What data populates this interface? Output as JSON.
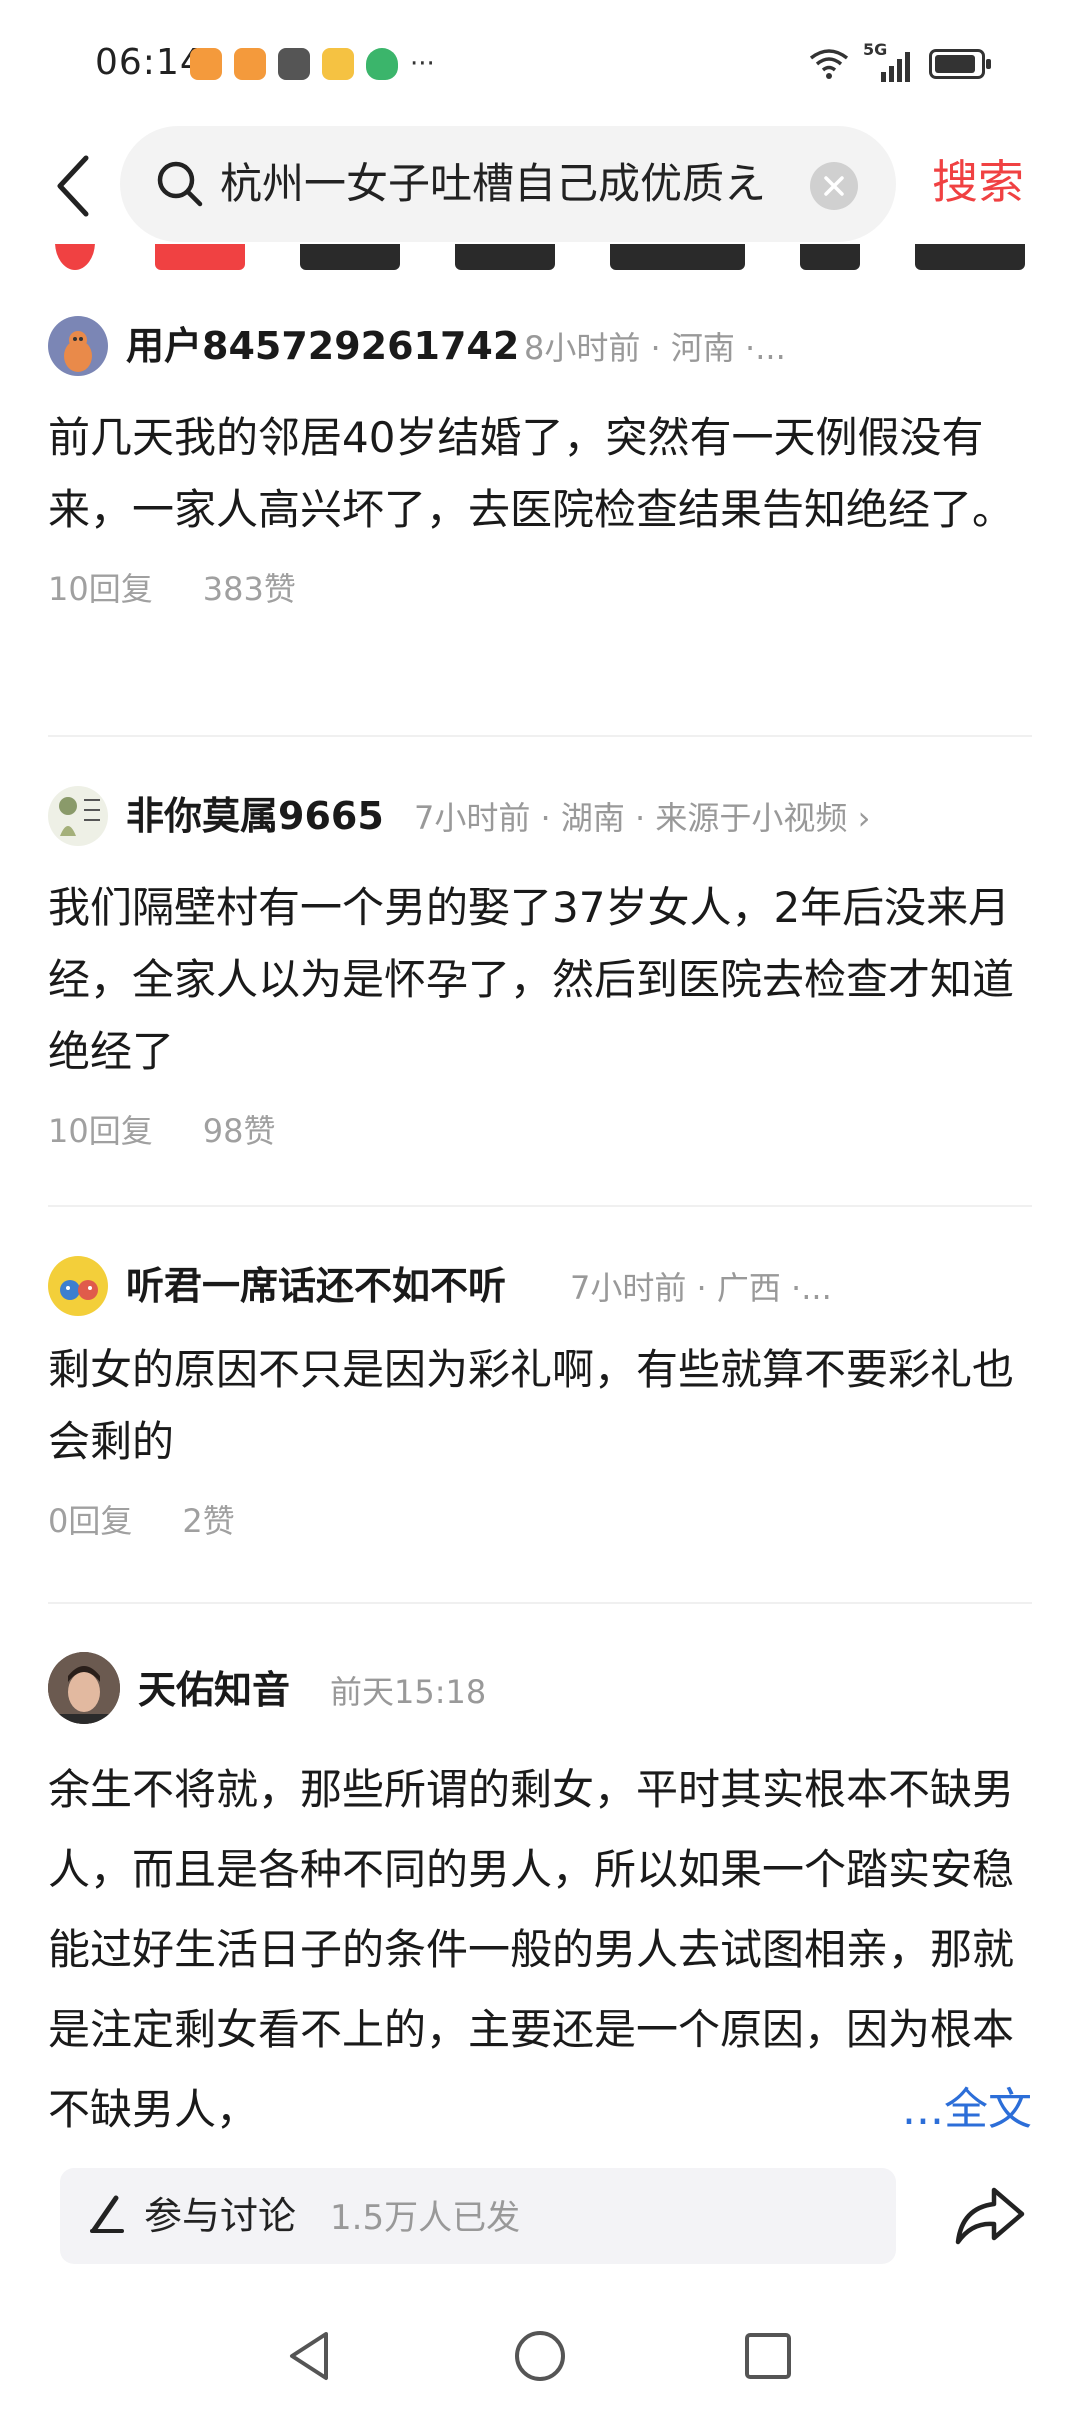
{
  "status_bar": {
    "time": "06:14",
    "network": "5G",
    "more": "···"
  },
  "search": {
    "query": "杭州一女子吐槽自己成优质え",
    "submit_label": "搜索"
  },
  "comments": [
    {
      "user": "用户845729261742",
      "meta": "8小时前 · 河南 ·...",
      "body": "前几天我的邻居40岁结婚了，突然有一天例假没有来，一家人高兴坏了，去医院检查结果告知绝经了。",
      "replies": "10回复",
      "likes": "383赞"
    },
    {
      "user": "非你莫属9665",
      "meta": "7小时前 · 湖南 · 来源于小视频 ›",
      "body": "我们隔壁村有一个男的娶了37岁女人，2年后没来月经，全家人以为是怀孕了，然后到医院去检查才知道绝经了",
      "replies": "10回复",
      "likes": "98赞"
    },
    {
      "user": "听君一席话还不如不听",
      "meta": "7小时前 · 广西 ·...",
      "body": "剩女的原因不只是因为彩礼啊，有些就算不要彩礼也会剩的",
      "replies": "0回复",
      "likes": "2赞"
    },
    {
      "user": "天佑知音",
      "meta": "前天15:18",
      "body": "余生不将就，那些所谓的剩女，平时其实根本不缺男人，而且是各种不同的男人，所以如果一个踏实安稳能过好生活日子的条件一般的男人去试图相亲，那就是注定剩女看不上的，主要还是一个原因，因为根本不缺男人，",
      "fulltext_label": "...全文"
    }
  ],
  "discuss": {
    "label": "参与讨论",
    "count": "1.5万人已发"
  },
  "colors": {
    "accent_red": "#f04142",
    "link_blue": "#2c6ed8",
    "meta_gray": "#999999"
  }
}
